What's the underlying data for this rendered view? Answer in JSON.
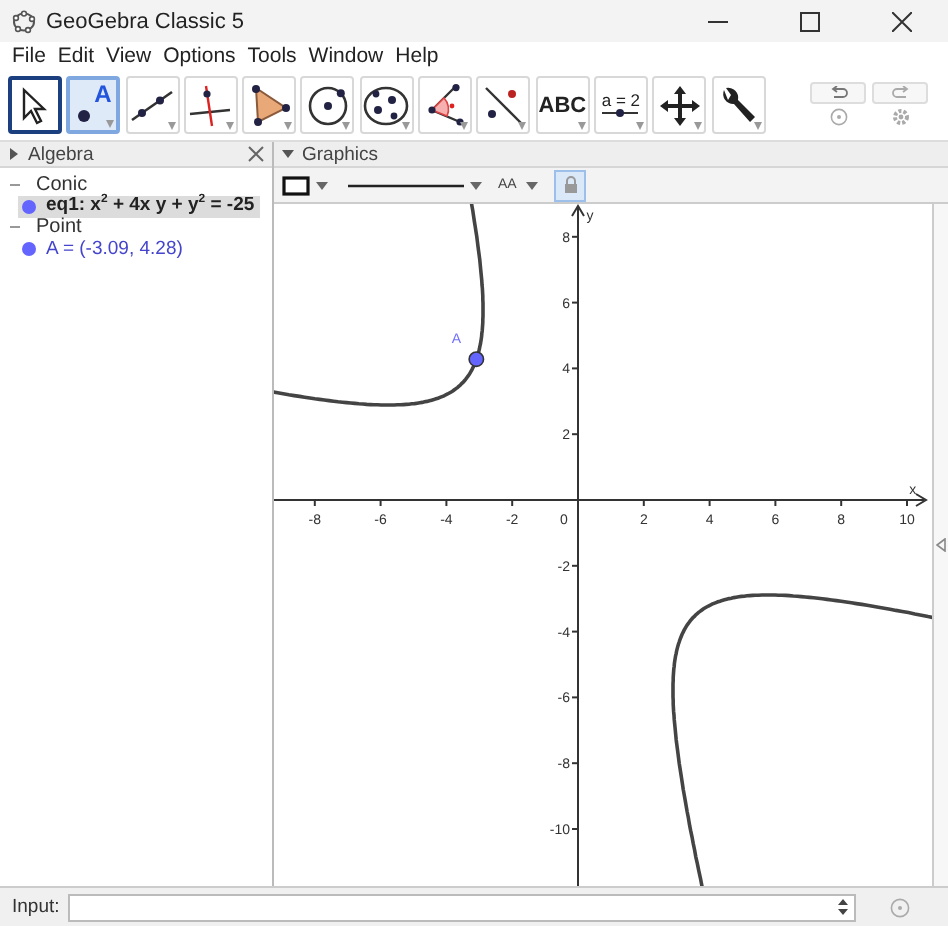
{
  "window": {
    "title": "GeoGebra Classic 5"
  },
  "menu": [
    "File",
    "Edit",
    "View",
    "Options",
    "Tools",
    "Window",
    "Help"
  ],
  "toolbar": [
    {
      "kind": "move",
      "selected": true,
      "highlighted": false
    },
    {
      "kind": "point",
      "label": "A",
      "selected": false,
      "highlighted": true
    },
    {
      "kind": "line",
      "selected": false,
      "highlighted": false
    },
    {
      "kind": "perpendicular",
      "selected": false,
      "highlighted": false
    },
    {
      "kind": "polygon",
      "selected": false,
      "highlighted": false
    },
    {
      "kind": "circle",
      "selected": false,
      "highlighted": false
    },
    {
      "kind": "conic",
      "selected": false,
      "highlighted": false
    },
    {
      "kind": "angle",
      "selected": false,
      "highlighted": false
    },
    {
      "kind": "reflect",
      "selected": false,
      "highlighted": false
    },
    {
      "kind": "text",
      "label": "ABC",
      "selected": false,
      "highlighted": false
    },
    {
      "kind": "slider",
      "label": "a = 2",
      "selected": false,
      "highlighted": false
    },
    {
      "kind": "move_view",
      "selected": false,
      "highlighted": false
    },
    {
      "kind": "tools",
      "selected": false,
      "highlighted": false
    }
  ],
  "algebra": {
    "title": "Algebra",
    "groups": [
      {
        "name": "Conic",
        "items": [
          {
            "text": "eq1: x$^{2}$ + 4x y + y$^{2}$ = -25",
            "color": "#6464ff",
            "selected": true
          }
        ]
      },
      {
        "name": "Point",
        "items": [
          {
            "text": "A = (-3.09, 4.28)",
            "color": "#6464ff",
            "selected": false
          }
        ]
      }
    ]
  },
  "graphics": {
    "title": "Graphics",
    "text_size_button": "AA",
    "x_axis_label": "x",
    "y_axis_label": "y",
    "origin_label": "0",
    "x_ticks": [
      "-8",
      "-6",
      "-4",
      "-2",
      "2",
      "4",
      "6",
      "8",
      "10"
    ],
    "y_ticks": [
      "8",
      "6",
      "4",
      "2",
      "-2",
      "-4",
      "-6",
      "-8",
      "-10"
    ],
    "point_label": "A"
  },
  "input_bar": {
    "label": "Input:"
  }
}
